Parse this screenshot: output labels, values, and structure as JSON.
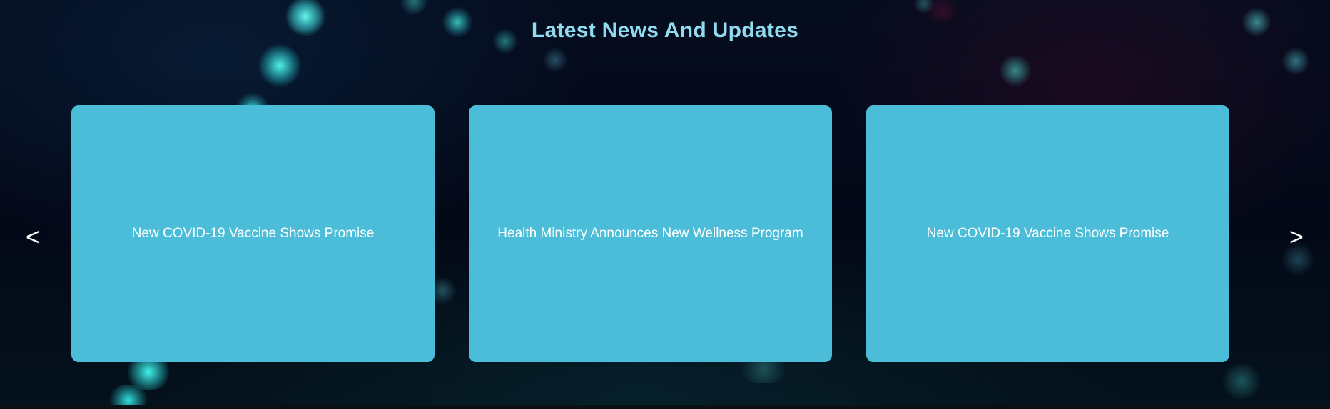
{
  "section": {
    "title": "Latest News And Updates"
  },
  "carousel": {
    "prev_label": "<",
    "next_label": ">",
    "cards": [
      {
        "title": "New COVID-19 Vaccine Shows Promise"
      },
      {
        "title": "Health Ministry Announces New Wellness Program"
      },
      {
        "title": "New COVID-19 Vaccine Shows Promise"
      },
      {
        "title": ""
      }
    ]
  },
  "colors": {
    "title": "#8fdcf0",
    "card_background": "#4bbdd9",
    "card_text": "#ffffff",
    "page_background": "#040a18"
  }
}
